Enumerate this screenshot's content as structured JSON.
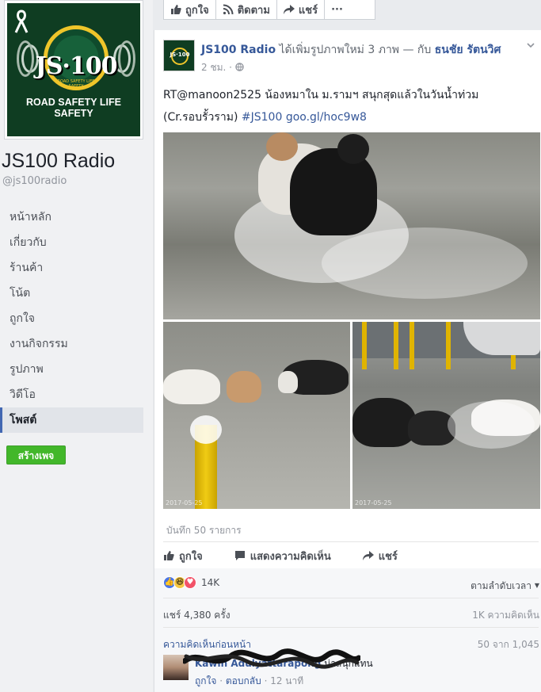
{
  "sidebar": {
    "cover_slogan": "ROAD SAFETY LIFE SAFETY",
    "cover_logo_text": "JS·100",
    "cover_logo_sub": "ROAD SAFETY LIFE SAFETY",
    "page_name": "JS100 Radio",
    "handle": "@js100radio",
    "nav": [
      {
        "label": "หน้าหลัก"
      },
      {
        "label": "เกี่ยวกับ"
      },
      {
        "label": "ร้านค้า"
      },
      {
        "label": "โน้ต"
      },
      {
        "label": "ถูกใจ"
      },
      {
        "label": "งานกิจกรรม"
      },
      {
        "label": "รูปภาพ"
      },
      {
        "label": "วิดีโอ"
      },
      {
        "label": "โพสต์"
      }
    ],
    "create_page": "สร้างเพจ"
  },
  "topbar": {
    "like": "ถูกใจ",
    "follow": "ติดตาม",
    "share": "แชร์",
    "more": "···"
  },
  "post": {
    "author": "JS100 Radio",
    "action": "ได้เพิ่มรูปภาพใหม่ 3 ภาพ — กับ",
    "tagged": "ธนชัย รัตนวิศ",
    "time": "2 ชม.",
    "avatar_text": "JS·100",
    "text_line1": "RT@manoon2525 น้องหมาใน ม.รามฯ สนุกสุดแล้วในวันน้ำท่วม",
    "text_line2_prefix": "(Cr.รอบรั้วราม)",
    "hashtag": "#JS100",
    "link": "goo.gl/hoc9w8",
    "photo_timestamp_1": "2017-05-25",
    "photo_timestamp_2": "2017-05-25",
    "saves": "บันทึก 50 รายการ",
    "actions": {
      "like": "ถูกใจ",
      "comment": "แสดงความคิดเห็น",
      "share": "แชร์"
    },
    "reaction_count": "14K",
    "sort_label": "ตามลำดับเวลา",
    "shares": "แชร์ 4,380 ครั้ง",
    "comment_count": "1K ความคิดเห็น",
    "previous_comments": "ความคิดเห็นก่อนหน้า",
    "pager": "50 จาก 1,045",
    "comment": {
      "who": "Kawin Adulyattarapong",
      "text": "น่าสนุกแทน",
      "like": "ถูกใจ",
      "reply": "ตอบกลับ",
      "time": "12 นาที"
    }
  },
  "colors": {
    "brand_blue": "#4267b2",
    "link_blue": "#365899",
    "green_button": "#42b72a",
    "logo_green": "#0f3d22",
    "logo_gold": "#efc52a"
  }
}
